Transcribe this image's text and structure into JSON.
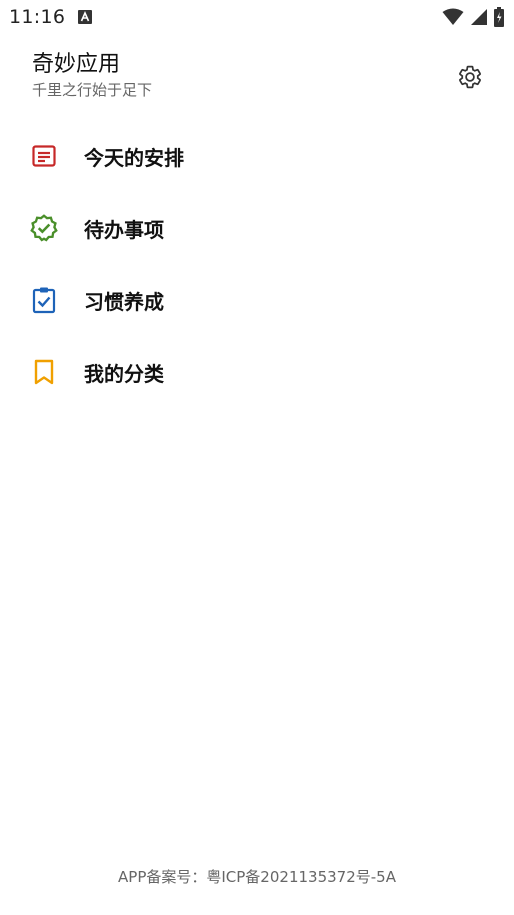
{
  "status_bar": {
    "time": "11:16"
  },
  "header": {
    "title": "奇妙应用",
    "subtitle": "千里之行始于足下"
  },
  "menu": {
    "items": [
      {
        "label": "今天的安排",
        "icon": "calendar-event-icon",
        "color": "#c62828"
      },
      {
        "label": "待办事项",
        "icon": "verified-check-icon",
        "color": "#4a8f2a"
      },
      {
        "label": "习惯养成",
        "icon": "clipboard-check-icon",
        "color": "#1e63b8"
      },
      {
        "label": "我的分类",
        "icon": "bookmark-icon",
        "color": "#f0a000"
      }
    ]
  },
  "footer": {
    "text": "APP备案号：粤ICP备2021135372号-5A"
  }
}
